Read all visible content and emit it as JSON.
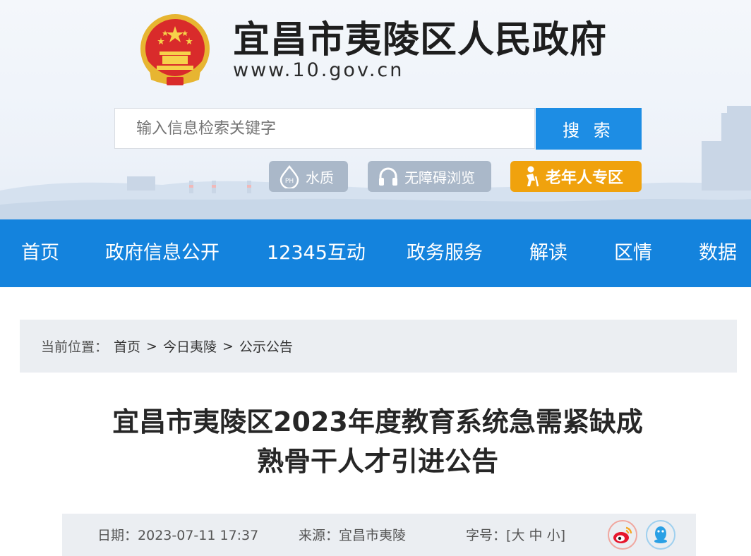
{
  "header": {
    "site_title": "宜昌市夷陵区人民政府",
    "site_url": "www.10.gov.cn",
    "emblem_icon": "national-emblem-icon",
    "search": {
      "placeholder": "输入信息检索关键字",
      "button_label": "搜 索"
    },
    "tools": [
      {
        "label": "水质",
        "icon": "water-quality-icon"
      },
      {
        "label": "无障碍浏览",
        "icon": "headphones-icon"
      },
      {
        "label": "老年人专区",
        "icon": "elder-icon"
      }
    ],
    "colors": {
      "search_button": "#1d8de4",
      "elder_zone": "#f0a20d",
      "tool_pill": "#aab8c9"
    }
  },
  "nav": {
    "color": "#1483dd",
    "items": [
      "首页",
      "政府信息公开",
      "12345互动",
      "政务服务",
      "解读",
      "区情",
      "数据"
    ]
  },
  "breadcrumb": {
    "prefix": "当前位置：",
    "items": [
      "首页",
      "今日夷陵",
      "公示公告"
    ],
    "separator": ">"
  },
  "article": {
    "title_line1": "宜昌市夷陵区2023年度教育系统急需紧缺成",
    "title_line2": "熟骨干人才引进公告",
    "date_label": "日期：",
    "date": "2023-07-11 17:37",
    "source_label": "来源：",
    "source": "宜昌市夷陵",
    "font_label": "字号：",
    "font_open": "[",
    "font_sizes": [
      "大",
      "中",
      "小"
    ],
    "font_close": "]",
    "share_icons": [
      "weibo-icon",
      "qq-icon"
    ]
  }
}
